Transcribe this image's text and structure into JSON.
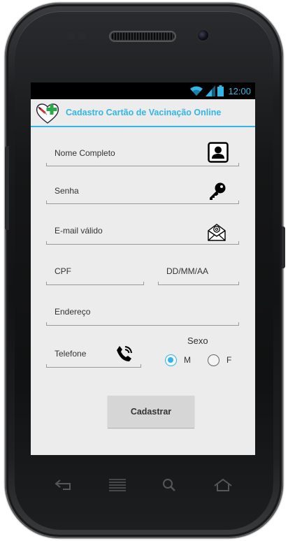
{
  "status_bar": {
    "time": "12:00"
  },
  "app": {
    "title": "Cadastro Cartão de Vacinação Online"
  },
  "form": {
    "full_name_placeholder": "Nome Completo",
    "password_placeholder": "Senha",
    "email_placeholder": "E-mail válido",
    "cpf_placeholder": "CPF",
    "birthdate_placeholder": "DD/MM/AA",
    "address_placeholder": "Endereço",
    "phone_placeholder": "Telefone",
    "sex_label": "Sexo",
    "sex_options": [
      {
        "label": "M",
        "selected": true
      },
      {
        "label": "F",
        "selected": false
      }
    ],
    "submit_label": "Cadastrar"
  },
  "icons": {
    "full_name": "contact-card-icon",
    "password": "key-icon",
    "email": "envelope-at-icon",
    "phone": "phone-call-icon"
  },
  "colors": {
    "accent": "#33b5e5",
    "screen_background": "#ececec",
    "button": "#d6d6d6"
  }
}
